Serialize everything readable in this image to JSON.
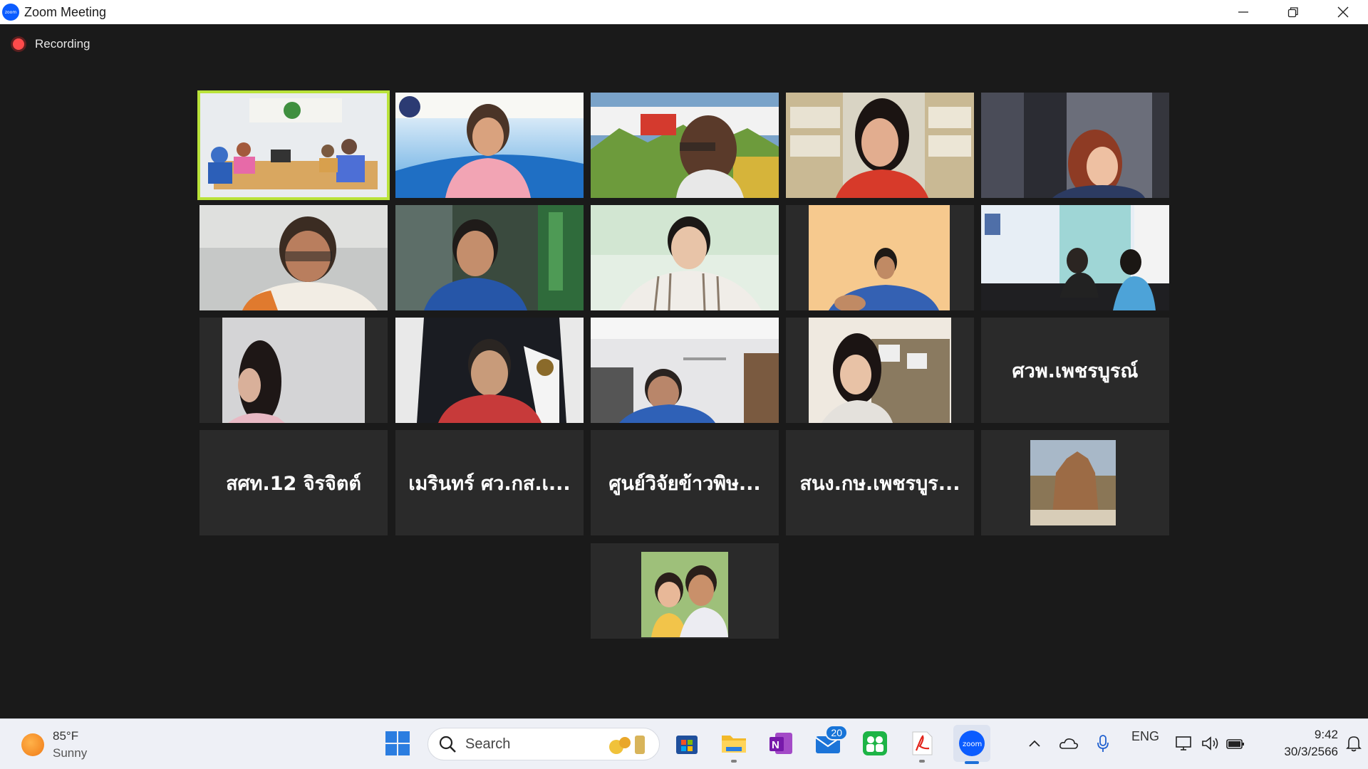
{
  "window": {
    "title": "Zoom Meeting",
    "logo_text": "zoom"
  },
  "meeting": {
    "recording_label": "Recording",
    "name_tiles": [
      "ศวพ.เพชรบูรณ์",
      "สศท.12 จิรจิตต์",
      "เมรินทร์ ศว.กส.เ...",
      "ศูนย์วิจัยข้าวพิษ...",
      "สนง.กษ.เพชรบูร..."
    ]
  },
  "taskbar": {
    "weather": {
      "temp": "85°F",
      "condition": "Sunny"
    },
    "search_placeholder": "Search",
    "mail_badge": "20",
    "language": "ENG",
    "time": "9:42",
    "date": "30/3/2566"
  },
  "colors": {
    "active_speaker": "#b9e23a",
    "recording_dot": "#ff4b4b",
    "zoom_blue": "#0b5cff"
  }
}
